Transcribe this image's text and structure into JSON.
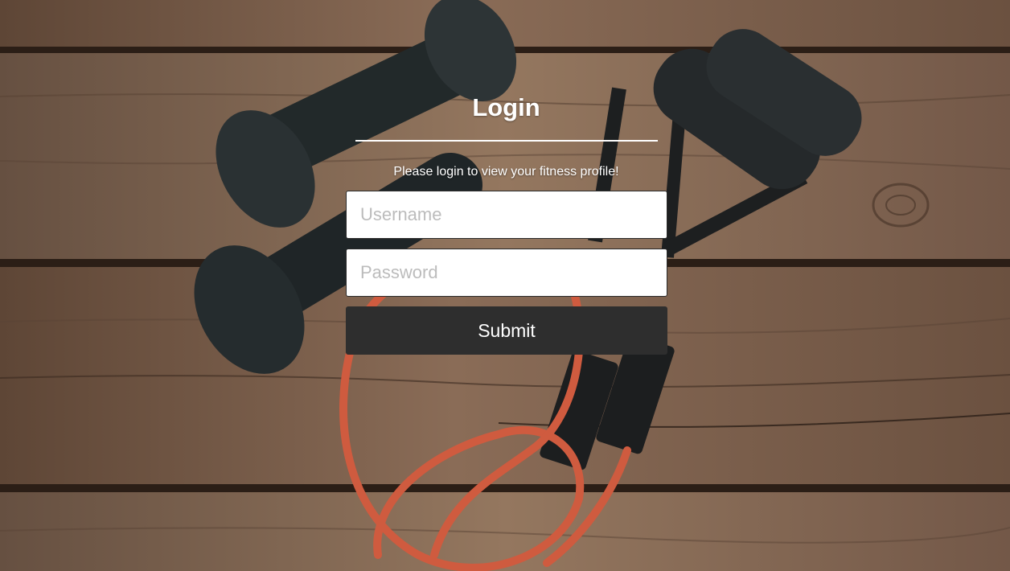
{
  "login": {
    "title": "Login",
    "subtitle": "Please login to view your fitness profile!",
    "username_placeholder": "Username",
    "password_placeholder": "Password",
    "submit_label": "Submit"
  },
  "background": {
    "description_icon": "wooden-floor-dumbbells-resistance-band-photo",
    "wood_color": "#7a5f4b",
    "dumbbell_color": "#23292a",
    "band_color": "#cf5b3f"
  },
  "colors": {
    "button": "#2e2e2e",
    "text_light": "#ffffff",
    "placeholder": "#bcbcbc"
  }
}
